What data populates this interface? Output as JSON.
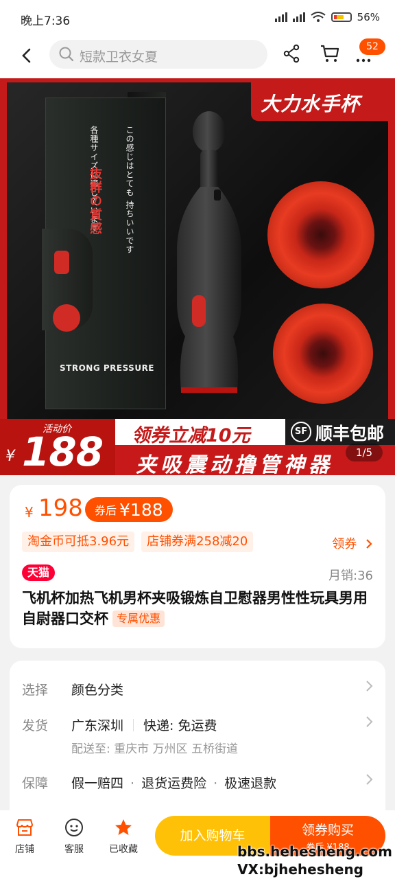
{
  "status_bar": {
    "time": "晚上7:36",
    "battery": "56%"
  },
  "topbar": {
    "search_placeholder": "短款卫衣女夏",
    "cart_badge": "52"
  },
  "gallery": {
    "tag": "大力水手杯",
    "box_text_1": "この感じはとても 持ちいいです",
    "box_text_2": "各種サイズに適しています",
    "box_highlight": "抜群の質感",
    "box_brand": "スーパーショック",
    "box_bottom": "STRONG PRESSURE",
    "activity_label": "活动价",
    "activity_currency": "¥",
    "activity_price": "188",
    "coupon_text": "领券立减10元",
    "sf_logo": "SF",
    "sf_text": "顺丰包邮",
    "slogan": "夹吸震动撸管神器",
    "pager": "1/5"
  },
  "price_card": {
    "currency": "¥",
    "price": "198",
    "after_label": "券后",
    "after_price": "¥188",
    "pills": [
      "淘金币可抵3.96元",
      "店铺券满258减20"
    ],
    "get_coupon": "领券",
    "tmall": "天猫",
    "monthly_sales": "月销:36",
    "title": "飞机杯加热飞机男杯夹吸锻炼自卫慰器男性性玩具男用自尉器口交杯",
    "exclusive": "专属优惠"
  },
  "spec_card": {
    "select_key": "选择",
    "select_value": "颜色分类",
    "ship_key": "发货",
    "ship_from": "广东深圳",
    "express": "快递: 免运费",
    "deliver_to": "配送至: 重庆市 万州区 五桥街道",
    "guarantee_key": "保障",
    "guarantee_1": "假一赔四",
    "guarantee_2": "退货运费险",
    "guarantee_3": "极速退款"
  },
  "bottombar": {
    "shop": "店铺",
    "service": "客服",
    "favorited": "已收藏",
    "add_cart": "加入购物车",
    "buy": "领券购买",
    "buy_sub": "券后 ¥188"
  },
  "watermark": {
    "line1": "bbs.hehesheng.com",
    "line2": "VX:bjhehesheng"
  }
}
